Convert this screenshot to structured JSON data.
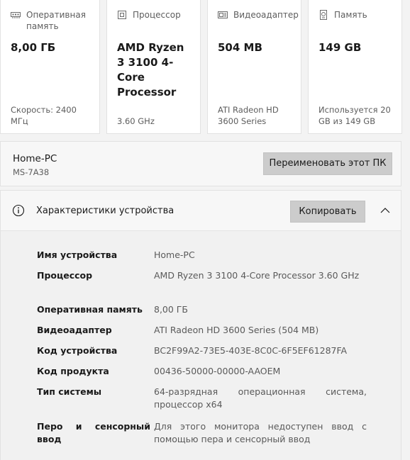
{
  "cards": [
    {
      "label": "Оперативная память",
      "value": "8,00 ГБ",
      "sub": "Скорость: 2400 МГц",
      "icon": "ram-icon"
    },
    {
      "label": "Процессор",
      "value": "AMD Ryzen 3 3100 4-Core Processor",
      "sub": "3.60 GHz",
      "icon": "processor-icon"
    },
    {
      "label": "Видеоадаптер",
      "value": "504 MB",
      "sub": "ATI Radeon HD 3600 Series",
      "icon": "gpu-icon"
    },
    {
      "label": "Память",
      "value": "149 GB",
      "sub": "Используется 20 GB из 149 GB",
      "icon": "storage-icon"
    }
  ],
  "pc": {
    "name": "Home-PC",
    "model": "MS-7A38",
    "rename_label": "Переименовать этот ПК"
  },
  "specs": {
    "title": "Характеристики устройства",
    "copy_label": "Копировать",
    "rows": [
      {
        "key": "Имя устройства",
        "value": "Home-PC"
      },
      {
        "key": "Процессор",
        "value": "AMD Ryzen 3 3100 4-Core Processor 3.60 GHz"
      },
      {
        "key": "Оперативная память",
        "value": "8,00 ГБ"
      },
      {
        "key": "Видеоадаптер",
        "value": "ATI Radeon HD 3600 Series (504 MB)"
      },
      {
        "key": "Код устройства",
        "value": "BC2F99A2-73E5-403E-8C0C-6F5EF61287FA"
      },
      {
        "key": "Код продукта",
        "value": "00436-50000-00000-AAOEM"
      },
      {
        "key": "Тип системы",
        "value": "64-разрядная операционная система, процессор x64"
      },
      {
        "key": "Перо и сенсорный ввод",
        "value": "Для этого монитора недоступен ввод с помощью пера и сенсорный ввод"
      }
    ]
  }
}
